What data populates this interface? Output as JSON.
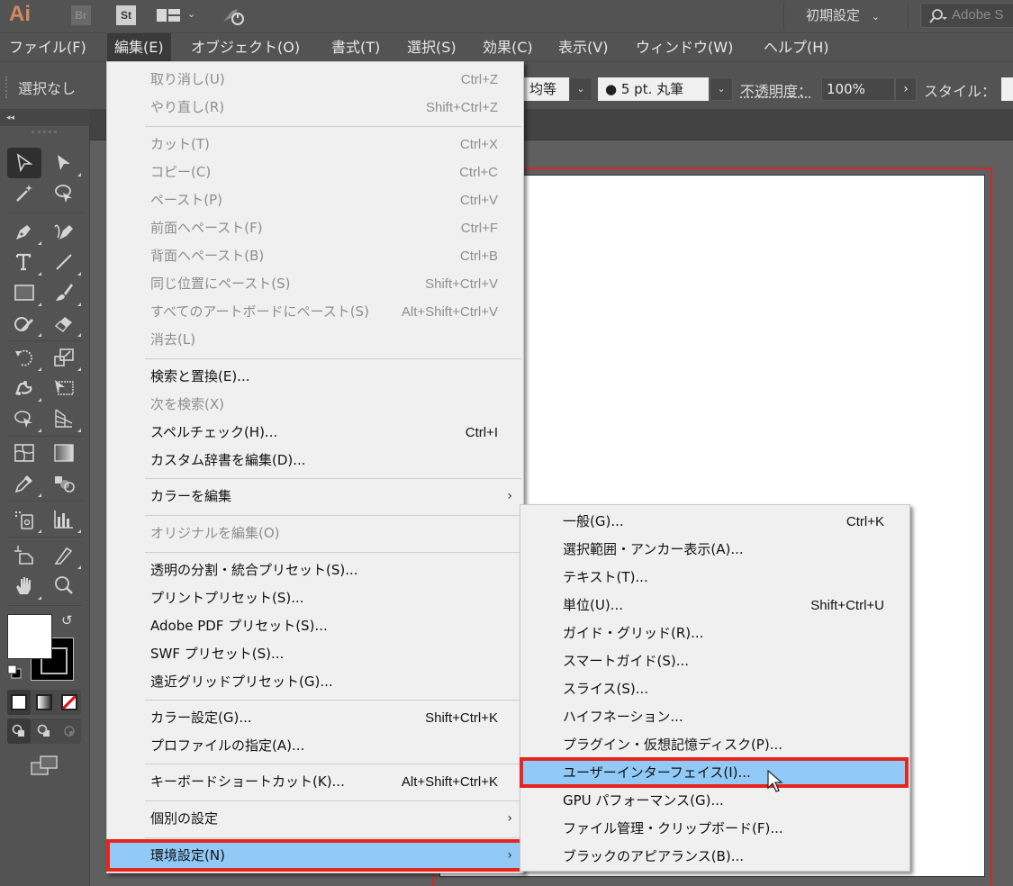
{
  "app_bar": {
    "logo": "Ai",
    "bridge_badge": "Br",
    "stock_badge": "St",
    "workspace": "初期設定",
    "search_placeholder": "Adobe S"
  },
  "menubar": {
    "items": [
      {
        "label": "ファイル(F)"
      },
      {
        "label": "編集(E)",
        "active": true
      },
      {
        "label": "オブジェクト(O)"
      },
      {
        "label": "書式(T)"
      },
      {
        "label": "選択(S)"
      },
      {
        "label": "効果(C)"
      },
      {
        "label": "表示(V)"
      },
      {
        "label": "ウィンドウ(W)"
      },
      {
        "label": "ヘルプ(H)"
      }
    ]
  },
  "control_bar": {
    "selection_status": "選択なし",
    "stroke_profile": "均等",
    "brush": "●  5 pt. 丸筆",
    "opacity_label": "不透明度：",
    "opacity_value": "100%",
    "style_label": "スタイル："
  },
  "toolbox": {
    "collapse_label": "◂◂"
  },
  "edit_menu": {
    "items": [
      {
        "label": "取り消し(U)",
        "shortcut": "Ctrl+Z",
        "disabled": true
      },
      {
        "label": "やり直し(R)",
        "shortcut": "Shift+Ctrl+Z",
        "disabled": true
      },
      {
        "label": "カット(T)",
        "shortcut": "Ctrl+X",
        "disabled": true
      },
      {
        "label": "コピー(C)",
        "shortcut": "Ctrl+C",
        "disabled": true
      },
      {
        "label": "ペースト(P)",
        "shortcut": "Ctrl+V",
        "disabled": true
      },
      {
        "label": "前面へペースト(F)",
        "shortcut": "Ctrl+F",
        "disabled": true
      },
      {
        "label": "背面へペースト(B)",
        "shortcut": "Ctrl+B",
        "disabled": true
      },
      {
        "label": "同じ位置にペースト(S)",
        "shortcut": "Shift+Ctrl+V",
        "disabled": true
      },
      {
        "label": "すべてのアートボードにペースト(S)",
        "shortcut": "Alt+Shift+Ctrl+V",
        "disabled": true
      },
      {
        "label": "消去(L)",
        "shortcut": "",
        "disabled": true
      },
      {
        "label": "検索と置換(E)...",
        "shortcut": "",
        "disabled": false
      },
      {
        "label": "次を検索(X)",
        "shortcut": "",
        "disabled": true
      },
      {
        "label": "スペルチェック(H)...",
        "shortcut": "Ctrl+I",
        "disabled": false
      },
      {
        "label": "カスタム辞書を編集(D)...",
        "shortcut": "",
        "disabled": false
      },
      {
        "label": "カラーを編集",
        "shortcut": "",
        "submenu": true,
        "disabled": false
      },
      {
        "label": "オリジナルを編集(O)",
        "shortcut": "",
        "disabled": true
      },
      {
        "label": "透明の分割・統合プリセット(S)...",
        "shortcut": "",
        "disabled": false
      },
      {
        "label": "プリントプリセット(S)...",
        "shortcut": "",
        "disabled": false
      },
      {
        "label": "Adobe PDF プリセット(S)...",
        "shortcut": "",
        "disabled": false
      },
      {
        "label": "SWF プリセット(S)...",
        "shortcut": "",
        "disabled": false
      },
      {
        "label": "遠近グリッドプリセット(G)...",
        "shortcut": "",
        "disabled": false
      },
      {
        "label": "カラー設定(G)...",
        "shortcut": "Shift+Ctrl+K",
        "disabled": false
      },
      {
        "label": "プロファイルの指定(A)...",
        "shortcut": "",
        "disabled": false
      },
      {
        "label": "キーボードショートカット(K)...",
        "shortcut": "Alt+Shift+Ctrl+K",
        "disabled": false
      },
      {
        "label": "個別の設定",
        "shortcut": "",
        "submenu": true,
        "disabled": false
      },
      {
        "label": "環境設定(N)",
        "shortcut": "",
        "submenu": true,
        "highlighted": true,
        "disabled": false
      }
    ]
  },
  "preferences_submenu": {
    "items": [
      {
        "label": "一般(G)...",
        "shortcut": "Ctrl+K"
      },
      {
        "label": "選択範囲・アンカー表示(A)...",
        "shortcut": ""
      },
      {
        "label": "テキスト(T)...",
        "shortcut": ""
      },
      {
        "label": "単位(U)...",
        "shortcut": "Shift+Ctrl+U"
      },
      {
        "label": "ガイド・グリッド(R)...",
        "shortcut": ""
      },
      {
        "label": "スマートガイド(S)...",
        "shortcut": ""
      },
      {
        "label": "スライス(S)...",
        "shortcut": ""
      },
      {
        "label": "ハイフネーション...",
        "shortcut": ""
      },
      {
        "label": "プラグイン・仮想記憶ディスク(P)...",
        "shortcut": ""
      },
      {
        "label": "ユーザーインターフェイス(I)...",
        "shortcut": "",
        "highlighted": true
      },
      {
        "label": "GPU パフォーマンス(G)...",
        "shortcut": ""
      },
      {
        "label": "ファイル管理・クリップボード(F)...",
        "shortcut": ""
      },
      {
        "label": "ブラックのアピアランス(B)...",
        "shortcut": ""
      }
    ]
  },
  "colors": {
    "highlight": "#91c9f7",
    "annotation_red": "#e8251d",
    "menu_bg": "#f0f0f0",
    "ui_dark": "#535353",
    "artboard_outline": "#d62727"
  }
}
